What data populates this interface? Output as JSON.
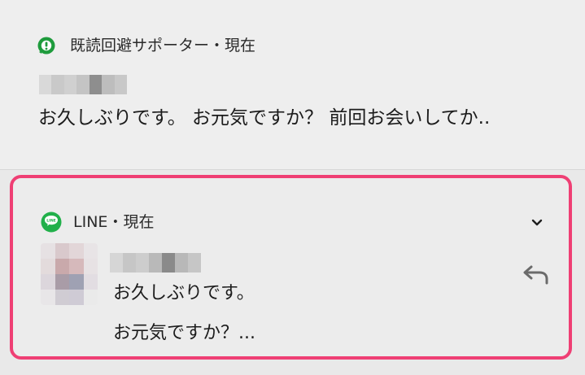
{
  "notification_1": {
    "app_name": "既読回避サポーター",
    "separator": "・",
    "time": "現在",
    "message": "お久しぶりです。 お元気ですか？ 前回お会いしてか..",
    "icon": "kidoku-support-app-icon",
    "icon_color": "#1e9b3c"
  },
  "notification_2": {
    "app_name": "LINE",
    "separator": "・",
    "time": "現在",
    "message_line_1": "お久しぶりです。",
    "message_line_2": "お元気ですか？...",
    "app_icon": "line-app-icon",
    "expand_icon": "chevron-down-icon",
    "reply_icon": "reply-icon",
    "avatar": "blurred-avatar",
    "highlight_color": "#ef3f74",
    "line_color": "#21b04a"
  }
}
